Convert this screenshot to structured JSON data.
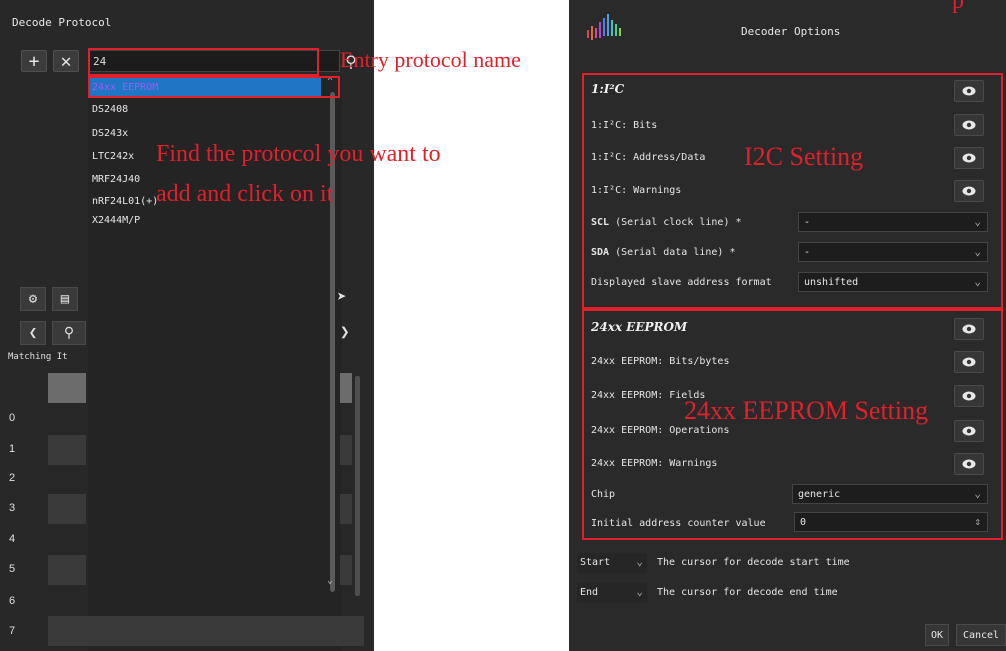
{
  "left": {
    "title": "Decode Protocol",
    "add_icon": "plus-icon",
    "remove_icon": "close-icon",
    "search_value": "24",
    "search_icon": "search-icon",
    "protocols": [
      "24xx EEPROM",
      "DS2408",
      "DS243x",
      "LTC242x",
      "MRF24J40",
      "nRF24L01(+)",
      "X2444M/P"
    ],
    "selected_protocol_index": 0,
    "matching_label": "Matching It",
    "row_numbers": [
      "0",
      "1",
      "2",
      "3",
      "4",
      "5",
      "6",
      "7"
    ]
  },
  "annotations": {
    "entry_name": "Entry protocol name",
    "find_line1": "Find the protocol you want to",
    "find_line2": "add and click on it",
    "i2c_setting": "I2C Setting",
    "eeprom_setting": "24xx EEPROM Setting",
    "top_clip": "p"
  },
  "right": {
    "title": "Decoder Options",
    "i2c_section": "1:I²C",
    "i2c_bits": "1:I²C: Bits",
    "i2c_address": "1:I²C: Address/Data",
    "i2c_warnings": "1:I²C: Warnings",
    "scl_bold": "SCL",
    "scl_rest": " (Serial clock line) *",
    "scl_value": "-",
    "sda_bold": "SDA",
    "sda_rest": " (Serial data line) *",
    "sda_value": "-",
    "slave_format_label": "Displayed slave address format",
    "slave_format_value": "unshifted",
    "eeprom_section": "24xx EEPROM",
    "eeprom_bits": "24xx EEPROM: Bits/bytes",
    "eeprom_fields": "24xx EEPROM: Fields",
    "eeprom_ops": "24xx EEPROM: Operations",
    "eeprom_warnings": "24xx EEPROM: Warnings",
    "chip_label": "Chip",
    "chip_value": "generic",
    "addr_counter_label": "Initial address counter value",
    "addr_counter_value": "0",
    "start_value": "Start",
    "start_desc": "The cursor for decode start time",
    "end_value": "End",
    "end_desc": "The cursor for decode end time",
    "ok_label": "OK",
    "cancel_label": "Cancel"
  },
  "colors": {
    "annotation_red": "#e0202a",
    "selection_blue": "#1e76c4",
    "panel_bg": "#282828"
  }
}
